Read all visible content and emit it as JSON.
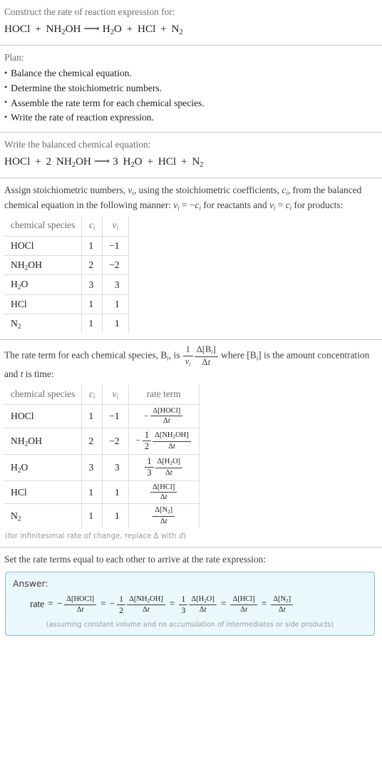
{
  "header": {
    "prompt": "Construct the rate of reaction expression for:",
    "equation_plain": "HOCl + NH2OH ⟶ H2O + HCl + N2"
  },
  "plan": {
    "label": "Plan:",
    "items": [
      "Balance the chemical equation.",
      "Determine the stoichiometric numbers.",
      "Assemble the rate term for each chemical species.",
      "Write the rate of reaction expression."
    ]
  },
  "balanced": {
    "label": "Write the balanced chemical equation:",
    "equation_plain": "HOCl + 2 NH2OH ⟶ 3 H2O + HCl + N2"
  },
  "assign": {
    "text_1": "Assign stoichiometric numbers, ",
    "text_2": ", using the stoichiometric coefficients, ",
    "text_3": ", from the balanced chemical equation in the following manner: ",
    "text_4": " for reactants and ",
    "text_5": " for products:"
  },
  "table1": {
    "headers": [
      "chemical species",
      "c_i",
      "v_i"
    ],
    "rows": [
      {
        "species": "HOCl",
        "c": "1",
        "v": "−1"
      },
      {
        "species": "NH2OH",
        "c": "2",
        "v": "−2"
      },
      {
        "species": "H2O",
        "c": "3",
        "v": "3"
      },
      {
        "species": "HCl",
        "c": "1",
        "v": "1"
      },
      {
        "species": "N2",
        "c": "1",
        "v": "1"
      }
    ]
  },
  "rate_term_intro": {
    "text_1": "The rate term for each chemical species, ",
    "text_2": ", is ",
    "text_3": " where ",
    "text_4": " is the amount concentration and ",
    "text_5": " is time:"
  },
  "table2": {
    "headers": [
      "chemical species",
      "c_i",
      "v_i",
      "rate term"
    ],
    "rows": [
      {
        "species": "HOCl",
        "c": "1",
        "v": "−1",
        "rate_plain": "− Δ[HOCl]/Δt"
      },
      {
        "species": "NH2OH",
        "c": "2",
        "v": "−2",
        "rate_plain": "− 1/2 Δ[NH2OH]/Δt"
      },
      {
        "species": "H2O",
        "c": "3",
        "v": "3",
        "rate_plain": "1/3 Δ[H2O]/Δt"
      },
      {
        "species": "HCl",
        "c": "1",
        "v": "1",
        "rate_plain": "Δ[HCl]/Δt"
      },
      {
        "species": "N2",
        "c": "1",
        "v": "1",
        "rate_plain": "Δ[N2]/Δt"
      }
    ],
    "footnote": "(for infinitesimal rate of change, replace Δ with d)"
  },
  "final": {
    "label": "Set the rate terms equal to each other to arrive at the rate expression:",
    "answer_title": "Answer:",
    "rate_word": "rate",
    "expression_plain": "rate = − Δ[HOCl]/Δt = − 1/2 Δ[NH2OH]/Δt = 1/3 Δ[H2O]/Δt = Δ[HCl]/Δt = Δ[N2]/Δt",
    "note": "(assuming constant volume and no accumulation of intermediates or side products)"
  },
  "symbols": {
    "delta": "Δ",
    "arrow": "⟶",
    "minus": "−",
    "equals": "=",
    "one": "1",
    "two": "2",
    "three": "3",
    "dt": "t",
    "nu": "ν",
    "c": "c",
    "i": "i",
    "B": "B"
  },
  "colors": {
    "rule": "#c8c8c8",
    "label_text": "#6e6e6e",
    "body_text": "#3c3c3c",
    "formula_text": "#1c1c1c",
    "table_border": "#dcdcdc",
    "answer_border": "#7fb8d4",
    "answer_bg": "#eaf7fc",
    "footnote_text": "#9a9a9a"
  }
}
